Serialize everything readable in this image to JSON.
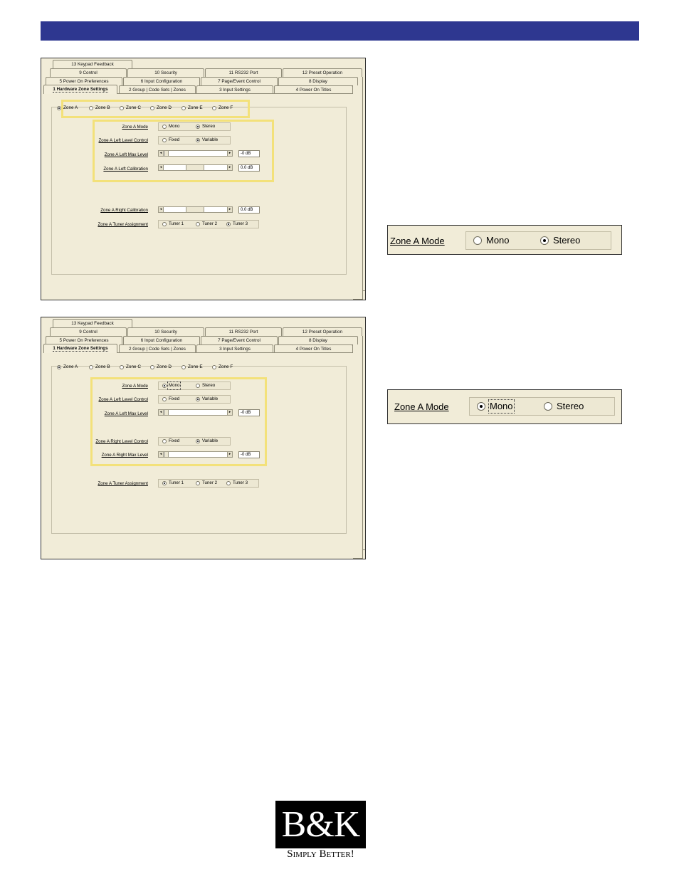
{
  "tabs": {
    "row1": [
      "13 Keypad Feedback"
    ],
    "row2": [
      "9  Control",
      "10  Security",
      "11  RS232 Port",
      "12  Preset Operation"
    ],
    "row3": [
      "5  Power On Preferences",
      "6  Input Configuration",
      "7  Page/Event Control",
      "8  Display"
    ],
    "row4": [
      "1  Hardware Zone Settings",
      "2  Group | Code Sets | Zones",
      "3  Input Settings",
      "4  Power On Titles"
    ]
  },
  "zones": [
    "Zone A",
    "Zone B",
    "Zone C",
    "Zone D",
    "Zone E",
    "Zone F"
  ],
  "screen1": {
    "mode_label": "Zone A Mode",
    "mode_options": [
      "Mono",
      "Stereo"
    ],
    "left_level_label": "Zone A Left Level Control",
    "level_options": [
      "Fixed",
      "Variable"
    ],
    "left_max_label": "Zone A Left Max Level",
    "left_max_value": "-0 dB",
    "left_cal_label": "Zone A Left Calibration",
    "left_cal_value": "0.0 dB",
    "right_cal_label": "Zone A Right Calibration",
    "right_cal_value": "0.0 dB",
    "tuner_label": "Zone A Tuner Assignment",
    "tuner_options": [
      "Tuner 1",
      "Tuner 2",
      "Tuner 3"
    ]
  },
  "screen2": {
    "mode_label": "Zone A Mode",
    "mode_options": [
      "Mono",
      "Stereo"
    ],
    "left_level_label": "Zone A Left Level Control",
    "level_options": [
      "Fixed",
      "Variable"
    ],
    "left_max_label": "Zone A Left Max Level",
    "left_max_value": "-0 dB",
    "right_level_label": "Zone A Right Level Control",
    "right_max_label": "Zone A Right Max Level",
    "right_max_value": "-0 dB",
    "tuner_label": "Zone A Tuner Assignment",
    "tuner_options": [
      "Tuner 1",
      "Tuner 2",
      "Tuner 3"
    ]
  },
  "zoom1": {
    "label": "Zone A Mode",
    "options": [
      "Mono",
      "Stereo"
    ]
  },
  "zoom2": {
    "label": "Zone A Mode",
    "options": [
      "Mono",
      "Stereo"
    ]
  },
  "logo": {
    "mark": "B&K",
    "tagline": "Simply Better!"
  },
  "colors": {
    "header": "#2e3790",
    "highlight": "#f3e17a",
    "panel": "#f1ecd8"
  }
}
